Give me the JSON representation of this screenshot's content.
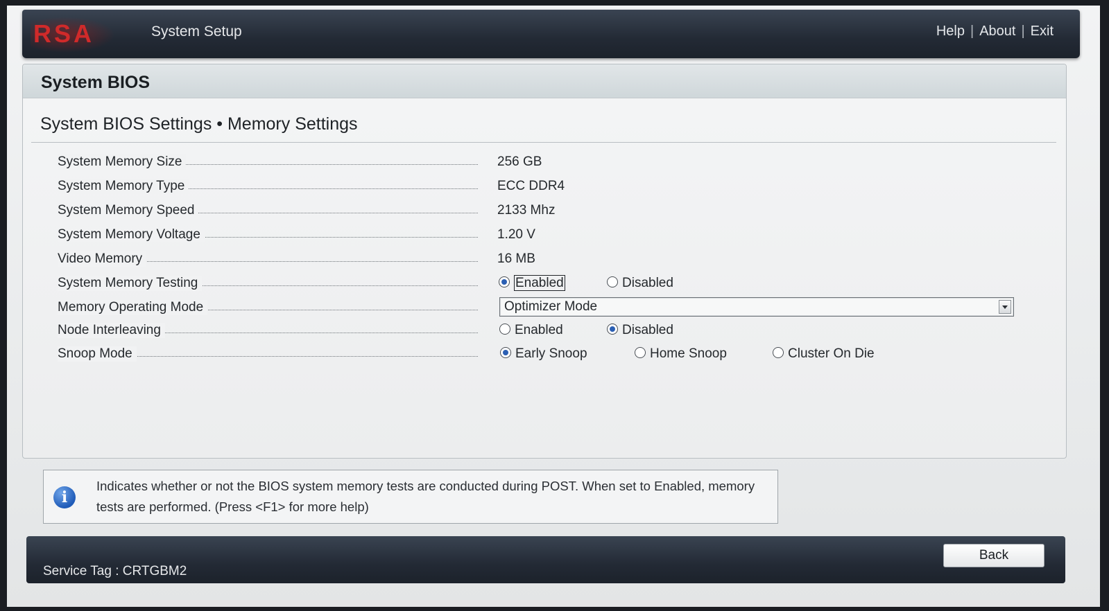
{
  "header": {
    "logo_text": "RSA",
    "title": "System Setup",
    "links": [
      "Help",
      "About",
      "Exit"
    ]
  },
  "panel": {
    "heading": "System BIOS",
    "breadcrumb": "System BIOS Settings • Memory Settings"
  },
  "settings": {
    "memory_size": {
      "label": "System Memory Size",
      "value": "256 GB"
    },
    "memory_type": {
      "label": "System Memory Type",
      "value": "ECC DDR4"
    },
    "memory_speed": {
      "label": "System Memory Speed",
      "value": "2133 Mhz"
    },
    "memory_voltage": {
      "label": "System Memory Voltage",
      "value": "1.20 V"
    },
    "video_memory": {
      "label": "Video Memory",
      "value": "16 MB"
    },
    "memory_testing": {
      "label": "System Memory Testing",
      "options": [
        "Enabled",
        "Disabled"
      ],
      "selected": "Enabled"
    },
    "operating_mode": {
      "label": "Memory Operating Mode",
      "value": "Optimizer Mode"
    },
    "node_interleaving": {
      "label": "Node Interleaving",
      "options": [
        "Enabled",
        "Disabled"
      ],
      "selected": "Disabled"
    },
    "snoop_mode": {
      "label": "Snoop Mode",
      "options": [
        "Early Snoop",
        "Home Snoop",
        "Cluster On Die"
      ],
      "selected": "Early Snoop"
    }
  },
  "info": {
    "text": "Indicates whether or not the BIOS system memory tests are conducted during POST. When set to Enabled, memory tests are performed. (Press <F1> for more help)"
  },
  "footer": {
    "service_tag": "Service Tag : CRTGBM2",
    "back_label": "Back"
  },
  "colors": {
    "bar_dark": "#232a35",
    "radio_selected": "#2b5fb3",
    "logo_red": "#c8282a"
  }
}
